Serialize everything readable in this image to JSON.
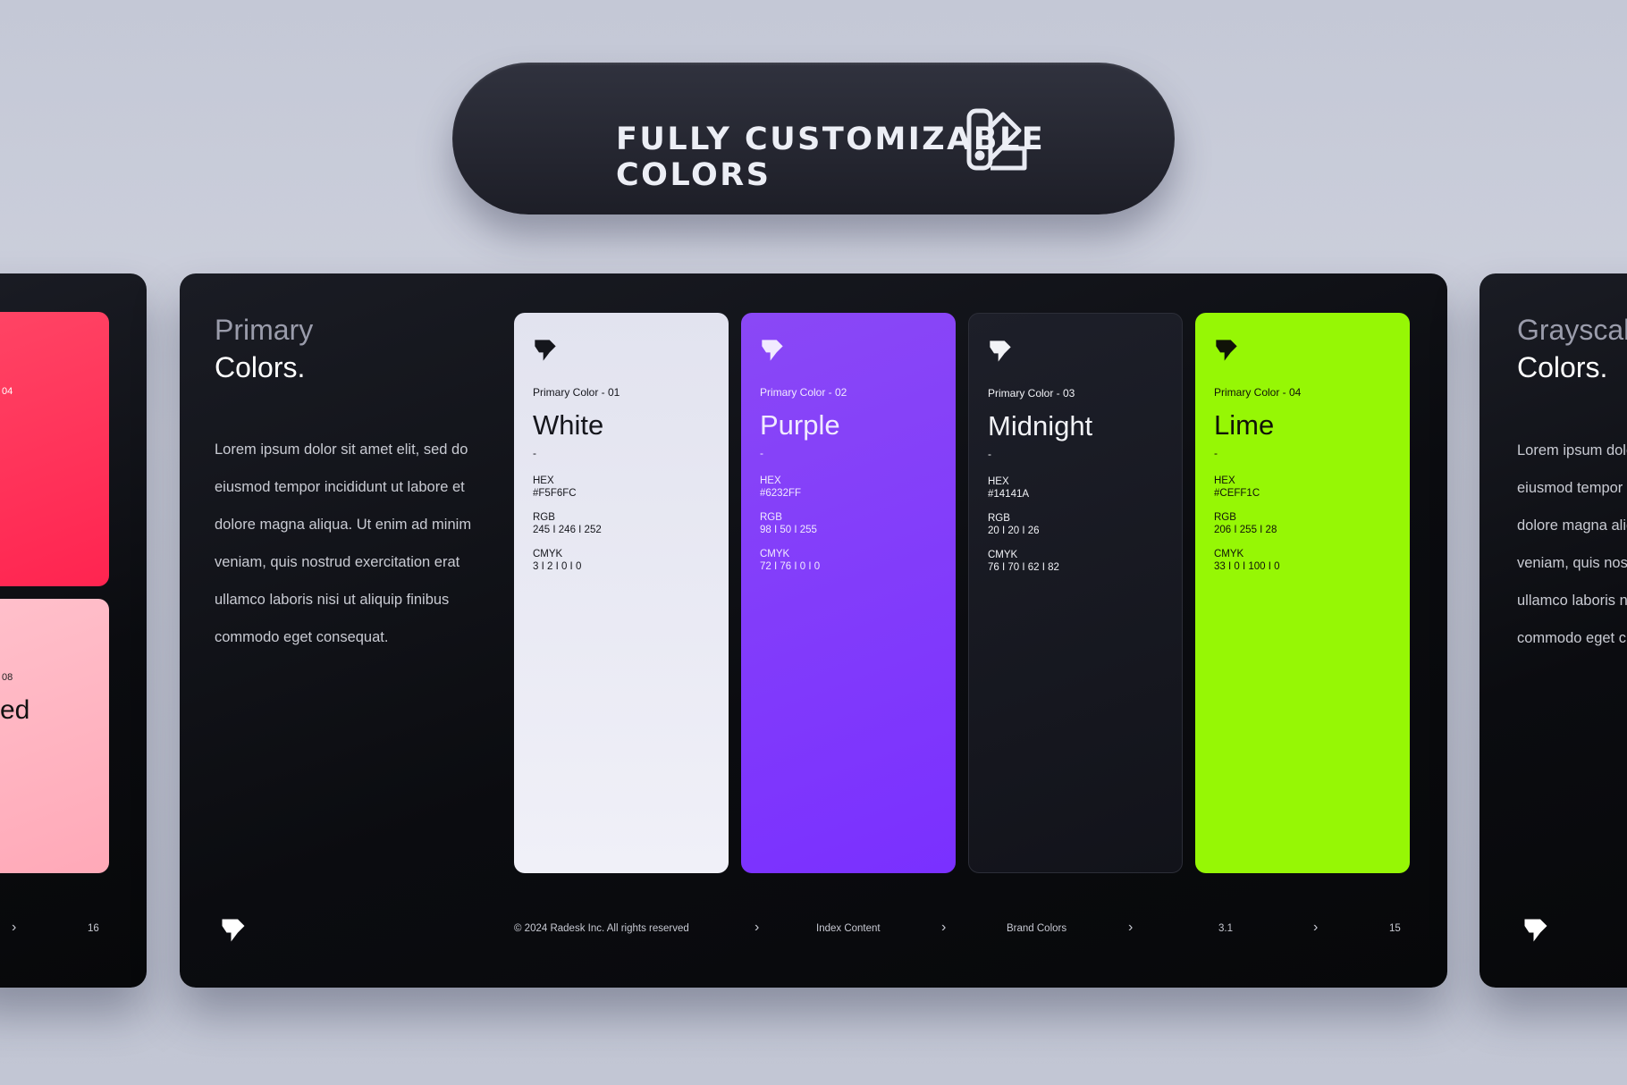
{
  "banner": {
    "title": "FULLY CUSTOMIZABLE COLORS",
    "icon": "swatch-palette-icon"
  },
  "left_slide": {
    "swatch_top_label": "04",
    "swatch_bottom_label": "08",
    "swatch_bottom_name": "ed",
    "page": "16",
    "swatch_colors": [
      "#ff2e55",
      "#ffb3c1"
    ]
  },
  "main_slide": {
    "title_line1": "Primary",
    "title_line2": "Colors.",
    "paragraph": [
      "Lorem ipsum dolor sit amet elit, sed do",
      "eiusmod tempor incididunt ut labore et",
      "dolore magna aliqua. Ut enim ad minim",
      "veniam, quis nostrud exercitation erat",
      "ullamco laboris nisi ut aliquip finibus",
      "commodo eget consequat."
    ],
    "colors": [
      {
        "label": "Primary Color - 01",
        "name": "White",
        "dash": "-",
        "hex_label": "HEX",
        "hex": "#F5F6FC",
        "rgb_label": "RGB",
        "rgb": "245 I 246 I 252",
        "cmyk_label": "CMYK",
        "cmyk": "3 I 2 I 0 I 0",
        "swatch": "#e6e7f2",
        "text": "#15161c"
      },
      {
        "label": "Primary Color - 02",
        "name": "Purple",
        "dash": "-",
        "hex_label": "HEX",
        "hex": "#6232FF",
        "rgb_label": "RGB",
        "rgb": "98 I 50 I 255",
        "cmyk_label": "CMYK",
        "cmyk": "72 I 76 I 0 I 0",
        "swatch": "#7f3cf8",
        "text": "#f1eaff"
      },
      {
        "label": "Primary Color - 03",
        "name": "Midnight",
        "dash": "-",
        "hex_label": "HEX",
        "hex": "#14141A",
        "rgb_label": "RGB",
        "rgb": "20 I 20 I 26",
        "cmyk_label": "CMYK",
        "cmyk": "76 I 70 I 62 I 82",
        "swatch": "#191b24",
        "text": "#f2f3f7"
      },
      {
        "label": "Primary Color - 04",
        "name": "Lime",
        "dash": "-",
        "hex_label": "HEX",
        "hex": "#CEFF1C",
        "rgb_label": "RGB",
        "rgb": "206 I 255 I 28",
        "cmyk_label": "CMYK",
        "cmyk": "33 I 0 I 100 I 0",
        "swatch": "#96f705",
        "text": "#101208"
      }
    ],
    "footer": {
      "copyright": "© 2024 Radesk Inc. All rights reserved",
      "index": "Index Content",
      "section": "Brand Colors",
      "number": "3.1",
      "page": "15"
    }
  },
  "right_slide": {
    "title_line1": "Grayscal",
    "title_line2": "Colors.",
    "paragraph": [
      "Lorem ipsum dolo",
      "eiusmod tempor",
      "dolore magna aliq",
      "veniam, quis nost",
      "ullamco laboris n",
      "commodo eget c"
    ]
  }
}
